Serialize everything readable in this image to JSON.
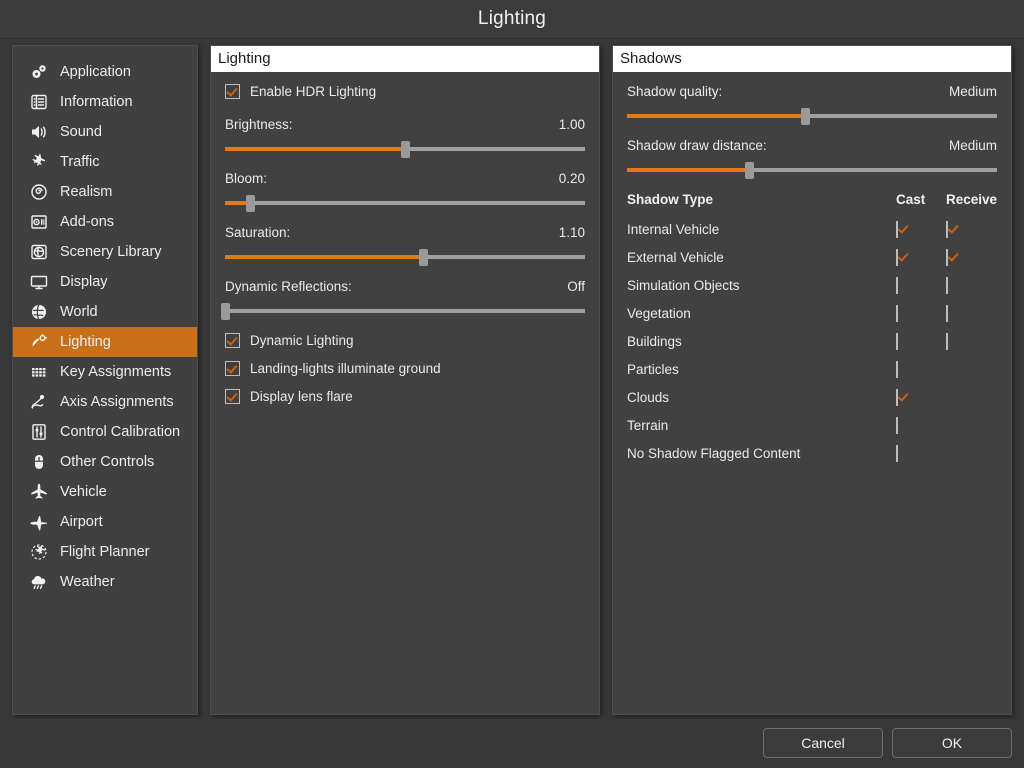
{
  "window": {
    "title": "Lighting"
  },
  "colors": {
    "accent": "#c87018",
    "slider_fill": "#e07b19",
    "check": "#cd5f14",
    "panel_bg": "#414141",
    "sidebar_bg": "#404040",
    "app_bg": "#383838",
    "header_bg": "#ffffff"
  },
  "sidebar": {
    "items": [
      {
        "label": "Application",
        "icon": "gears-icon",
        "active": false
      },
      {
        "label": "Information",
        "icon": "list-card-icon",
        "active": false
      },
      {
        "label": "Sound",
        "icon": "speaker-icon",
        "active": false
      },
      {
        "label": "Traffic",
        "icon": "traffic-planes-icon",
        "active": false
      },
      {
        "label": "Realism",
        "icon": "spiral-gauge-icon",
        "active": false
      },
      {
        "label": "Add-ons",
        "icon": "addon-box-icon",
        "active": false
      },
      {
        "label": "Scenery Library",
        "icon": "globe-square-icon",
        "active": false
      },
      {
        "label": "Display",
        "icon": "monitor-icon",
        "active": false
      },
      {
        "label": "World",
        "icon": "globe-icon",
        "active": false
      },
      {
        "label": "Lighting",
        "icon": "lamp-icon",
        "active": true
      },
      {
        "label": "Key Assignments",
        "icon": "keyboard-icon",
        "active": false
      },
      {
        "label": "Axis Assignments",
        "icon": "joystick-icon",
        "active": false
      },
      {
        "label": "Control Calibration",
        "icon": "sliders-icon",
        "active": false
      },
      {
        "label": "Other Controls",
        "icon": "mouse-icon",
        "active": false
      },
      {
        "label": "Vehicle",
        "icon": "airplane-top-icon",
        "active": false
      },
      {
        "label": "Airport",
        "icon": "airplane-side-icon",
        "active": false
      },
      {
        "label": "Flight Planner",
        "icon": "flight-route-icon",
        "active": false
      },
      {
        "label": "Weather",
        "icon": "cloud-rain-icon",
        "active": false
      }
    ]
  },
  "lighting_panel": {
    "header": "Lighting",
    "enable_hdr": {
      "label": "Enable HDR Lighting",
      "checked": true
    },
    "sliders": [
      {
        "label": "Brightness:",
        "value": "1.00",
        "percent": 50
      },
      {
        "label": "Bloom:",
        "value": "0.20",
        "percent": 7
      },
      {
        "label": "Saturation:",
        "value": "1.10",
        "percent": 55
      },
      {
        "label": "Dynamic Reflections:",
        "value": "Off",
        "percent": 0
      }
    ],
    "checkboxes": [
      {
        "label": "Dynamic Lighting",
        "checked": true
      },
      {
        "label": "Landing-lights illuminate ground",
        "checked": true
      },
      {
        "label": "Display lens flare",
        "checked": true
      }
    ]
  },
  "shadows_panel": {
    "header": "Shadows",
    "sliders": [
      {
        "label": "Shadow quality:",
        "value": "Medium",
        "percent": 48
      },
      {
        "label": "Shadow draw distance:",
        "value": "Medium",
        "percent": 33
      }
    ],
    "table": {
      "columns": [
        "Shadow Type",
        "Cast",
        "Receive"
      ],
      "rows": [
        {
          "type": "Internal Vehicle",
          "cast": true,
          "cast_present": true,
          "receive": true,
          "receive_present": true
        },
        {
          "type": "External Vehicle",
          "cast": true,
          "cast_present": true,
          "receive": true,
          "receive_present": true
        },
        {
          "type": "Simulation Objects",
          "cast": false,
          "cast_present": true,
          "receive": false,
          "receive_present": true
        },
        {
          "type": "Vegetation",
          "cast": false,
          "cast_present": true,
          "receive": false,
          "receive_present": true
        },
        {
          "type": "Buildings",
          "cast": false,
          "cast_present": true,
          "receive": false,
          "receive_present": true
        },
        {
          "type": "Particles",
          "cast": false,
          "cast_present": true,
          "receive": false,
          "receive_present": false
        },
        {
          "type": "Clouds",
          "cast": true,
          "cast_present": true,
          "receive": false,
          "receive_present": false
        },
        {
          "type": "Terrain",
          "cast": false,
          "cast_present": true,
          "receive": false,
          "receive_present": false
        },
        {
          "type": "No Shadow Flagged Content",
          "cast": false,
          "cast_present": true,
          "receive": false,
          "receive_present": false
        }
      ]
    }
  },
  "footer": {
    "cancel_label": "Cancel",
    "ok_label": "OK"
  }
}
